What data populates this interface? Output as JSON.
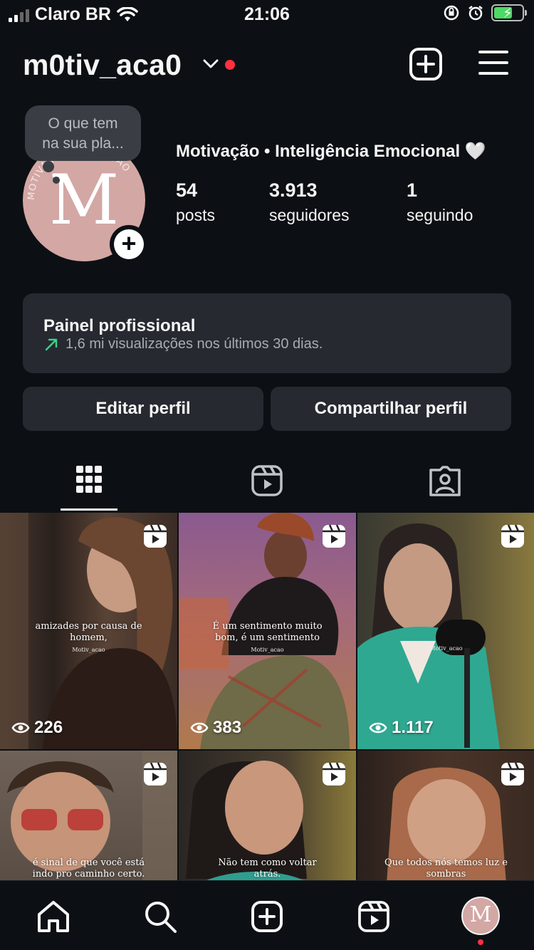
{
  "status_bar": {
    "carrier": "Claro BR",
    "time": "21:06"
  },
  "header": {
    "username": "m0tiv_aca0",
    "has_notification_dot": true
  },
  "note": {
    "text_line1": "O que tem",
    "text_line2": "na sua pla..."
  },
  "profile": {
    "avatar_letter": "M",
    "avatar_ring_text": "MOTIVAÇÃO MOTIVAÇÃO",
    "bio_name": "Motivação • Inteligência Emocional 🤍",
    "stats": [
      {
        "value": "54",
        "label": "posts"
      },
      {
        "value": "3.913",
        "label": "seguidores"
      },
      {
        "value": "1",
        "label": "seguindo"
      }
    ]
  },
  "panel": {
    "title": "Painel profissional",
    "subtitle": "1,6 mi visualizações nos últimos 30 dias."
  },
  "buttons": {
    "edit": "Editar perfil",
    "share": "Compartilhar perfil"
  },
  "tabs": [
    "grid-icon",
    "reels-icon",
    "tagged-icon"
  ],
  "grid": [
    {
      "caption": [
        "amizades por causa de",
        "homem,"
      ],
      "watermark": "Motiv_acao",
      "views": "226",
      "bg": "#3c2f2a",
      "accent": "#7a5a48"
    },
    {
      "caption": [
        "É um sentimento muito",
        "bom, é um sentimento"
      ],
      "watermark": "Motiv_acao",
      "views": "383",
      "bg": "#7b4d82",
      "accent": "#c07b54"
    },
    {
      "caption": [],
      "watermark": "Motiv_acao",
      "views": "1.117",
      "bg": "#2c3a35",
      "accent": "#37b29a"
    },
    {
      "caption": [
        "é sinal de que você está",
        "indo pro caminho certo."
      ],
      "watermark": "",
      "views": "",
      "bg": "#4a3d35",
      "accent": "#b8332f"
    },
    {
      "caption": [
        "Não tem como voltar",
        "atrás."
      ],
      "watermark": "",
      "views": "",
      "bg": "#2e2a26",
      "accent": "#2f9e8f"
    },
    {
      "caption": [
        "Que todos nós temos luz e",
        "sombras"
      ],
      "watermark": "",
      "views": "",
      "bg": "#3a2a22",
      "accent": "#a86a4a"
    }
  ],
  "bottom_nav": [
    "home-icon",
    "search-icon",
    "create-icon",
    "reels-icon",
    "profile-avatar"
  ],
  "colors": {
    "background": "#0c1014",
    "surface": "#262a30",
    "accent_red": "#ff3040",
    "trend_green": "#3fd08a"
  }
}
